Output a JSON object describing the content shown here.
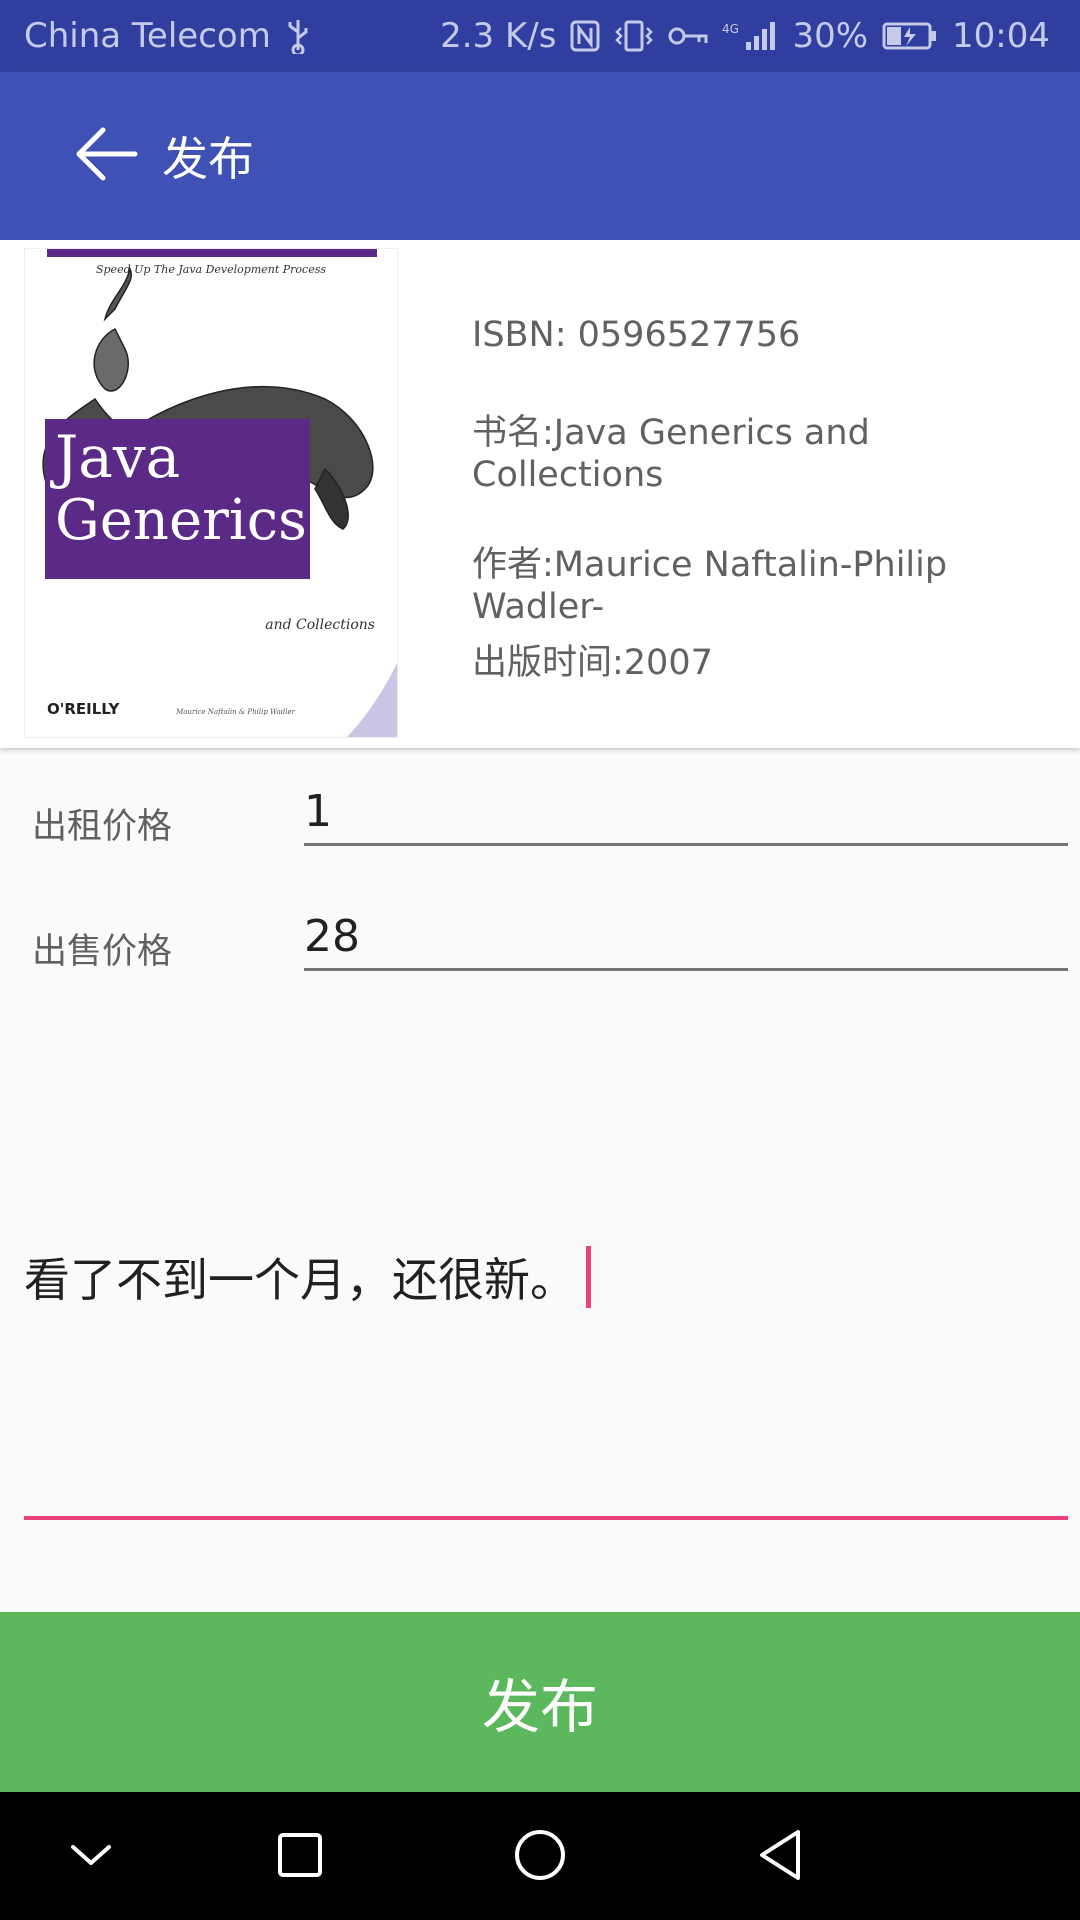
{
  "status_bar": {
    "carrier": "China Telecom",
    "speed": "2.3 K/s",
    "network": "4G",
    "battery": "30%",
    "time": "10:04"
  },
  "app_bar": {
    "title": "发布"
  },
  "book": {
    "isbn": "ISBN: 0596527756",
    "title": "书名:Java Generics and Collections",
    "author": "作者:Maurice Naftalin-Philip Wadler-",
    "publish_time": "出版时间:2007",
    "cover": {
      "top_line": "Speed Up The Java Development Process",
      "title_line1": "Java",
      "title_line2": "Generics",
      "subtitle": "and Collections",
      "publisher": "O'REILLY",
      "authors_small": "Maurice Naftalin & Philip Wadler"
    }
  },
  "form": {
    "rent_label": "出租价格",
    "rent_value": "1",
    "sale_label": "出售价格",
    "sale_value": "28",
    "description": "看了不到一个月，还很新。"
  },
  "publish_button": "发布",
  "colors": {
    "status_bar": "#303f9f",
    "app_bar": "#3f51b5",
    "accent": "#ec407a",
    "publish": "#5cb85c"
  }
}
